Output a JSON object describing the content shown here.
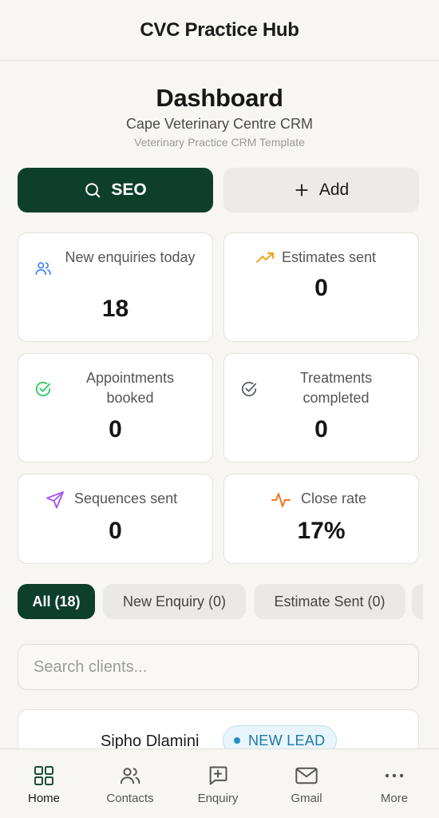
{
  "app": {
    "title": "CVC Practice Hub"
  },
  "header": {
    "title": "Dashboard",
    "subtitle": "Cape Veterinary Centre CRM",
    "caption": "Veterinary Practice CRM Template"
  },
  "actions": {
    "seo_label": "SEO",
    "add_label": "Add"
  },
  "stats": [
    {
      "label": "New enquiries today",
      "value": "18",
      "icon": "users-icon",
      "color": "#3b82f6"
    },
    {
      "label": "Estimates sent",
      "value": "0",
      "icon": "trending-up-icon",
      "color": "#f59e0b"
    },
    {
      "label": "Appointments booked",
      "value": "0",
      "icon": "check-circle-icon",
      "color": "#22c55e"
    },
    {
      "label": "Treatments completed",
      "value": "0",
      "icon": "check-circle-icon",
      "color": "#6b7280"
    },
    {
      "label": "Sequences sent",
      "value": "0",
      "icon": "send-icon",
      "color": "#a855f7"
    },
    {
      "label": "Close rate",
      "value": "17%",
      "icon": "activity-icon",
      "color": "#f97316"
    }
  ],
  "filters": [
    {
      "label": "All (18)",
      "active": true
    },
    {
      "label": "New Enquiry (0)",
      "active": false
    },
    {
      "label": "Estimate Sent (0)",
      "active": false
    }
  ],
  "search": {
    "placeholder": "Search clients...",
    "value": ""
  },
  "clients": [
    {
      "name": "Sipho Dlamini",
      "status": "NEW LEAD",
      "status_color": "#1d78a8"
    }
  ],
  "nav": [
    {
      "label": "Home",
      "icon": "grid-icon",
      "active": true
    },
    {
      "label": "Contacts",
      "icon": "users-icon",
      "active": false
    },
    {
      "label": "Enquiry",
      "icon": "message-plus-icon",
      "active": false
    },
    {
      "label": "Gmail",
      "icon": "mail-icon",
      "active": false
    },
    {
      "label": "More",
      "icon": "more-icon",
      "active": false
    }
  ],
  "colors": {
    "brand": "#0d3f2b",
    "background": "#f7f6f3",
    "badge": "#1d78a8"
  }
}
